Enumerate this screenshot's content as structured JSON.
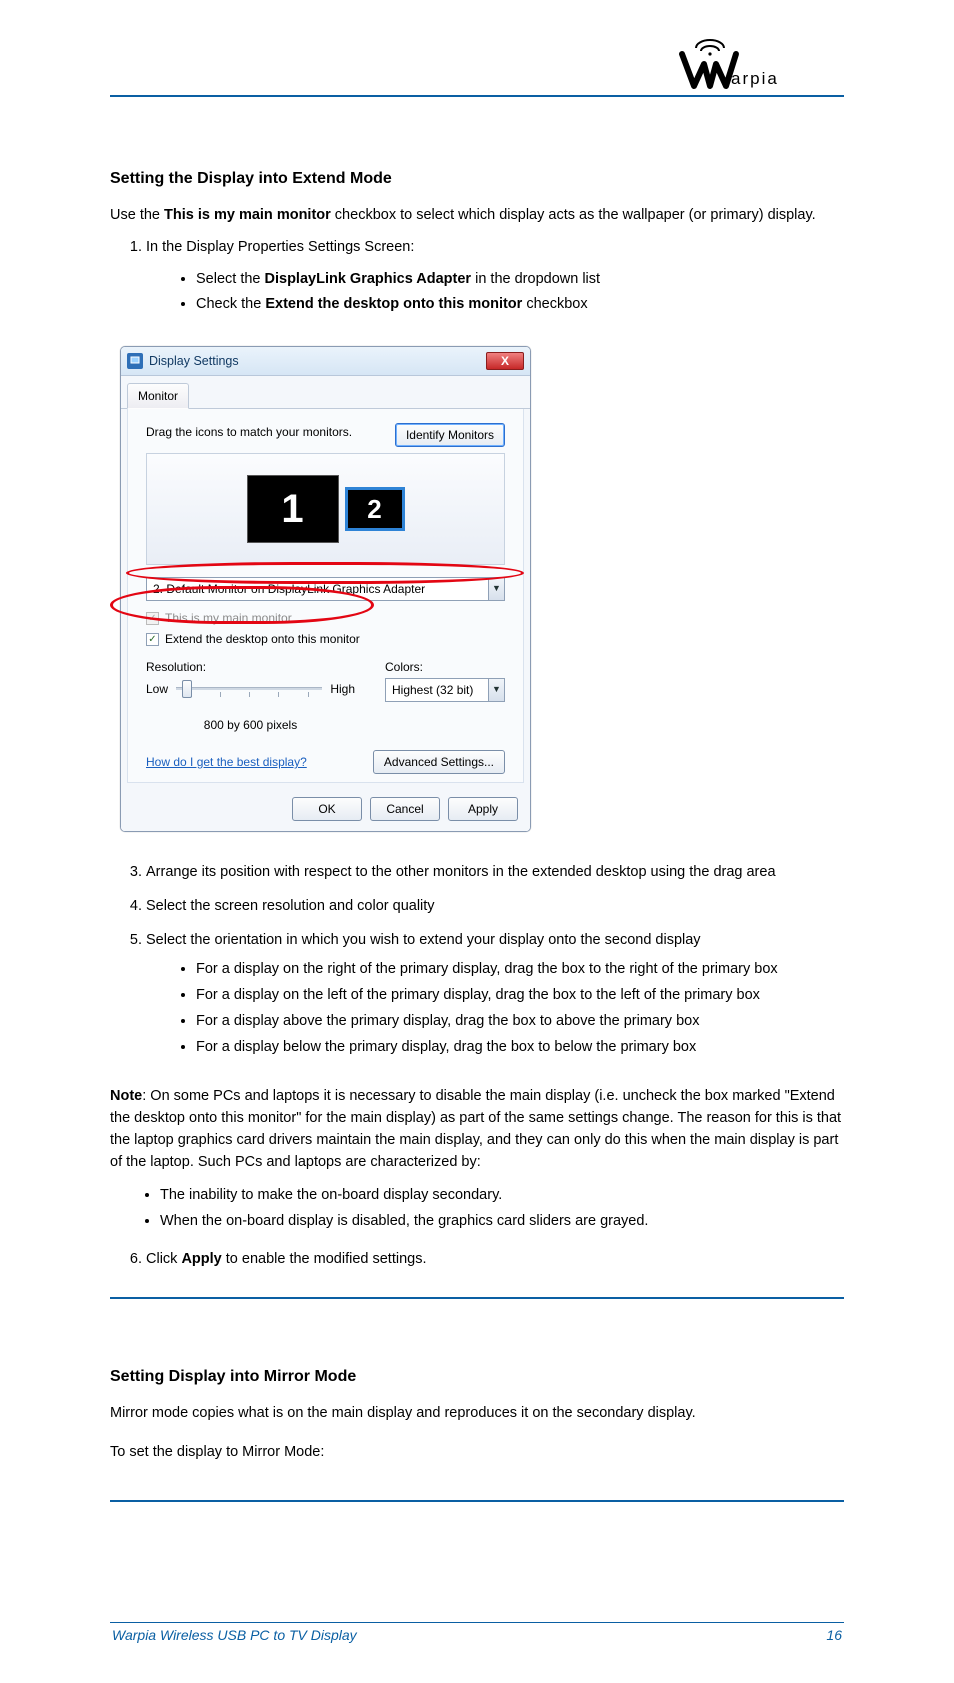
{
  "logo_text": "arpia",
  "section1": {
    "title": "Setting the Display into Extend Mode",
    "step1_prefix": "Use the ",
    "step1_bold": "This is my main monitor",
    "step1_suffix": " checkbox to select which display acts as the wallpaper (or primary) display.",
    "step2": "In the Display Properties Settings Screen:",
    "step2_b1_prefix": "Select the ",
    "step2_b1_bold": "DisplayLink Graphics Adapter",
    "step2_b1_suffix": " in the dropdown list",
    "step2_b2_prefix": "Check the ",
    "step2_b2_bold": "Extend the desktop onto this monitor",
    "step2_b2_suffix": " checkbox"
  },
  "dialog": {
    "title": "Display Settings",
    "tab": "Monitor",
    "instruction": "Drag the icons to match your monitors.",
    "identify_btn": "Identify Monitors",
    "monitor1": "1",
    "monitor2": "2",
    "dropdown_value": "2. Default Monitor on DisplayLink Graphics Adapter",
    "chk_main": "This is my main monitor",
    "chk_extend": "Extend the desktop onto this monitor",
    "resolution_label": "Resolution:",
    "low": "Low",
    "high": "High",
    "res_value": "800 by 600 pixels",
    "colors_label": "Colors:",
    "colors_value": "Highest (32 bit)",
    "link": "How do I get the best display?",
    "advanced_btn": "Advanced Settings...",
    "ok": "OK",
    "cancel": "Cancel",
    "apply": "Apply",
    "close_x": "X"
  },
  "afterSteps": {
    "s3": "Arrange its position with respect to the other monitors in the extended desktop using the drag area",
    "s4": "Select the screen resolution and color quality",
    "s5_prefix": "Select the orientation in which you wish to extend your display onto the second display",
    "s5_b1": "For a display on the right of the primary display, drag the box to the right of the primary box",
    "s5_b2": "For a display on the left of the primary display, drag the box to the left of the primary box",
    "s5_b3": "For a display above the primary display, drag the box to above the primary box",
    "s5_b4": "For a display below the primary display, drag the box to below the primary box"
  },
  "note": {
    "lead": "Note",
    "text": ": On some PCs and laptops it is necessary to disable the main display (i.e. uncheck the box marked \"Extend the desktop onto this monitor\" for the main display) as part of the same settings change. The reason for this is that the laptop graphics card drivers maintain the main display, and they can only do this when the main display is part of the laptop. Such PCs and laptops are characterized by:",
    "b1": "The inability to make the on-board display secondary.",
    "b2": "When the on-board display is disabled, the graphics card sliders are grayed.",
    "s6_prefix": "Click ",
    "s6_bold": "Apply",
    "s6_suffix": " to enable the modified settings."
  },
  "section2": {
    "title": "Setting Display into Mirror Mode",
    "intro": "Mirror mode copies what is on the main display and reproduces it on the secondary display.",
    "lead": "To set the display to Mirror Mode:"
  },
  "footer": {
    "left": "Warpia Wireless USB PC to TV Display",
    "page": "16"
  }
}
